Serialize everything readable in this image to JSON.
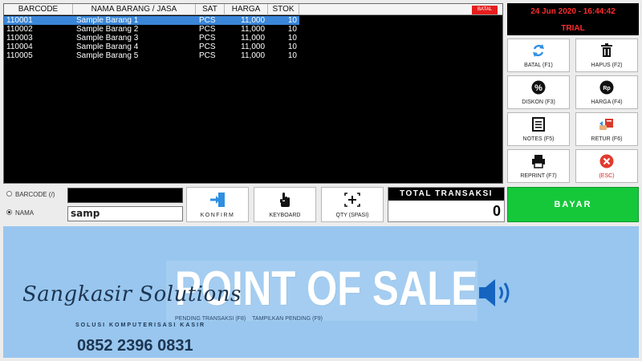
{
  "grid": {
    "columns": [
      "BARCODE",
      "NAMA BARANG / JASA",
      "SAT",
      "HARGA",
      "STOK"
    ],
    "badge": "BATAL",
    "rows": [
      {
        "barcode": "110001",
        "nama": "Sample Barang 1",
        "sat": "PCS",
        "harga": "11,000",
        "stok": "10",
        "selected": true
      },
      {
        "barcode": "110002",
        "nama": "Sample Barang 2",
        "sat": "PCS",
        "harga": "11,000",
        "stok": "10",
        "selected": false
      },
      {
        "barcode": "110003",
        "nama": "Sample Barang 3",
        "sat": "PCS",
        "harga": "11,000",
        "stok": "10",
        "selected": false
      },
      {
        "barcode": "110004",
        "nama": "Sample Barang 4",
        "sat": "PCS",
        "harga": "11,000",
        "stok": "10",
        "selected": false
      },
      {
        "barcode": "110005",
        "nama": "Sample Barang 5",
        "sat": "PCS",
        "harga": "11,000",
        "stok": "10",
        "selected": false
      }
    ]
  },
  "status": {
    "datetime": "24 Jun 2020 - 16:44:42",
    "license": "TRIAL"
  },
  "function_buttons": [
    {
      "label": "BATAL (F1)",
      "icon": "refresh-arrows-icon"
    },
    {
      "label": "HAPUS (F2)",
      "icon": "trash-icon"
    },
    {
      "label": "DISKON (F3)",
      "icon": "percent-icon"
    },
    {
      "label": "HARGA (F4)",
      "icon": "price-tag-icon"
    },
    {
      "label": "NOTES (F5)",
      "icon": "notes-icon"
    },
    {
      "label": "RETUR (F6)",
      "icon": "return-icon"
    },
    {
      "label": "REPRINT (F7)",
      "icon": "printer-icon"
    },
    {
      "label": "(ESC)",
      "icon": "close-circle-icon"
    }
  ],
  "search": {
    "barcode_label": "BARCODE (/)",
    "nama_label": "NAMA",
    "nama_value": "samp",
    "selected_mode": "NAMA"
  },
  "actions": {
    "konfirm": "KONFIRM",
    "keyboard": "KEYBOARD",
    "qty": "QTY (SPASI)"
  },
  "total": {
    "title": "TOTAL TRANSAKSI",
    "value": "0"
  },
  "pay": {
    "label": "BAYAR"
  },
  "banner": {
    "title": "POINT OF SALE",
    "hint_pending": "PENDING TRANSAKSI (F8)",
    "hint_show": "TAMPILKAN PENDING (F9)",
    "brand_name": "Sangkasir Solutions",
    "brand_tagline": "SOLUSI KOMPUTERISASI KASIR",
    "phone": "0852 2396 0831"
  },
  "colors": {
    "grid_bg": "#000000",
    "selected_row": "#3a86d8",
    "clock_red": "#ff2b2b",
    "pay_green": "#15c83a",
    "banner_blue": "#98c6ef"
  }
}
